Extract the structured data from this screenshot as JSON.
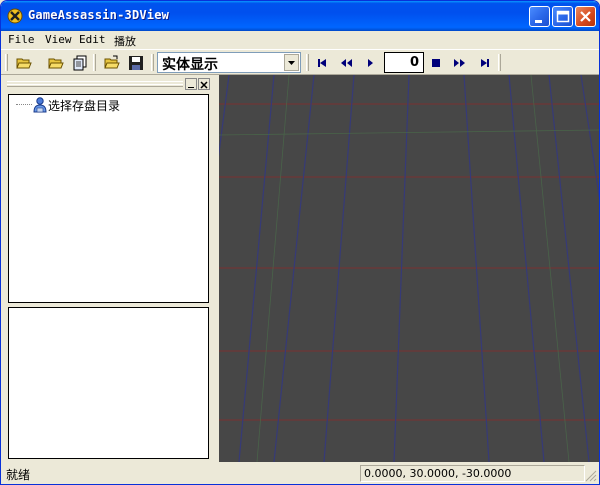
{
  "window": {
    "title": "GameAssassin-3DView"
  },
  "menu": {
    "items": [
      "File",
      "View",
      "Edit",
      "播放"
    ]
  },
  "toolbar": {
    "buttons": [
      "open-folder-icon",
      "open-icon",
      "copy-icon",
      "open-file-icon",
      "save-icon"
    ],
    "display_mode": "实体显示",
    "playback": [
      "first-frame-icon",
      "rewind-icon",
      "play-icon",
      "stop-icon",
      "fast-forward-icon",
      "last-frame-icon"
    ],
    "frame": "0"
  },
  "tree": {
    "root_label": "选择存盘目录"
  },
  "status": {
    "left": "就绪",
    "coords": "0.0000, 30.0000, -30.0000"
  },
  "colors": {
    "viewport_bg": "#474747",
    "grid_red": "#7a3232",
    "grid_blue": "#363a78",
    "grid_green": "#4a6a4a",
    "titlebar": "#0053ee"
  }
}
